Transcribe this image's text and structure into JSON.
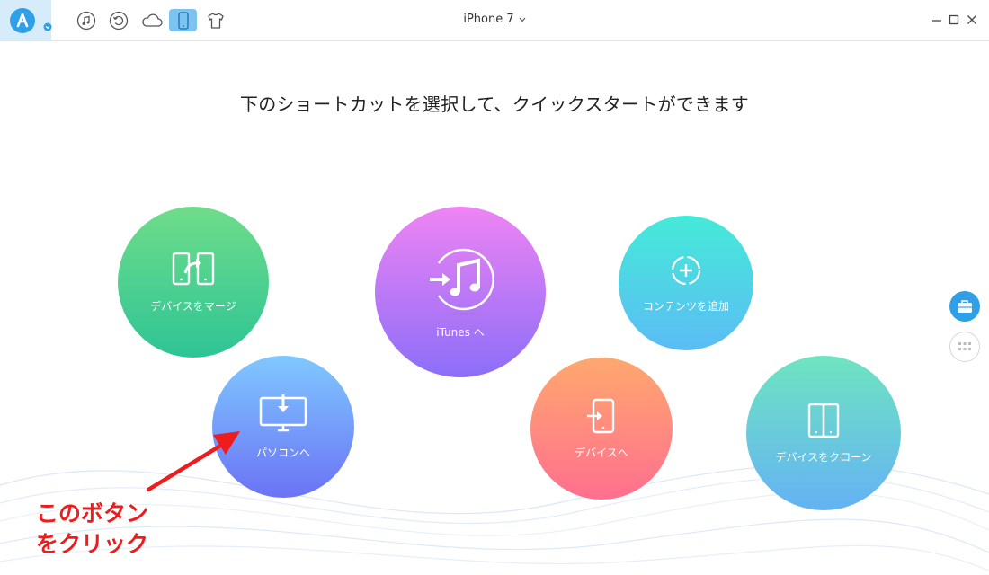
{
  "toolbar": {
    "app_logo": "a-icon",
    "tools": [
      {
        "name": "music-icon"
      },
      {
        "name": "history-icon"
      },
      {
        "name": "cloud-icon"
      },
      {
        "name": "phone-icon",
        "active": true
      },
      {
        "name": "tshirt-icon"
      }
    ],
    "device_name": "iPhone 7",
    "accent_color": "#2f9fe8"
  },
  "heading": "下のショートカットを選択して、クイックスタートができます",
  "shortcuts": [
    {
      "label": "デバイスをマージ",
      "icon": "merge-icon"
    },
    {
      "label": "iTunes へ",
      "icon": "itunes-icon"
    },
    {
      "label": "コンテンツを追加",
      "icon": "add-content-icon"
    },
    {
      "label": "パソコンへ",
      "icon": "to-pc-icon"
    },
    {
      "label": "デバイスへ",
      "icon": "to-device-icon"
    },
    {
      "label": "デバイスをクローン",
      "icon": "clone-icon"
    }
  ],
  "side_buttons": [
    {
      "name": "toolbox-icon"
    },
    {
      "name": "apps-grid-icon"
    }
  ],
  "annotation": {
    "line1": "このボタン",
    "line2": "をクリック",
    "color": "#ee1c1c"
  }
}
